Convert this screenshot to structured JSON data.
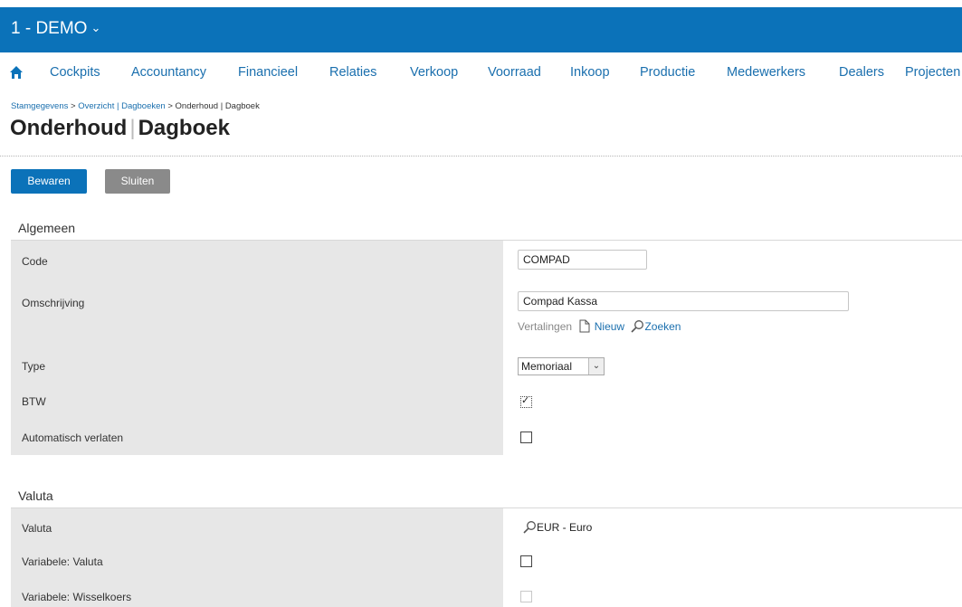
{
  "header": {
    "company": "1 - DEMO"
  },
  "menu": {
    "items": [
      "Cockpits",
      "Accountancy",
      "Financieel",
      "Relaties",
      "Verkoop",
      "Voorraad",
      "Inkoop",
      "Productie",
      "Medewerkers",
      "Dealers",
      "Projecten"
    ]
  },
  "breadcrumb": {
    "root": "Stamgegevens",
    "sep1": ">",
    "overview": "Overzicht | Dagboeken",
    "sep2": ">",
    "current": "Onderhoud | Dagboek"
  },
  "page": {
    "title_main": "Onderhoud",
    "title_sep": "|",
    "title_sub": "Dagboek"
  },
  "toolbar": {
    "save_label": "Bewaren",
    "close_label": "Sluiten"
  },
  "general": {
    "heading": "Algemeen",
    "code_label": "Code",
    "code_value": "COMPAD",
    "description_label": "Omschrijving",
    "description_value": "Compad Kassa",
    "translations_label": "Vertalingen",
    "new_link": "Nieuw",
    "search_link": "Zoeken",
    "type_label": "Type",
    "type_value": "Memoriaal",
    "vat_label": "BTW",
    "vat_checked": true,
    "auto_leave_label": "Automatisch verlaten",
    "auto_leave_checked": false
  },
  "currency": {
    "heading": "Valuta",
    "currency_label": "Valuta",
    "currency_value": "EUR - Euro",
    "var_currency_label": "Variabele: Valuta",
    "var_rate_label": "Variabele: Wisselkoers"
  },
  "colors": {
    "brand": "#0b72b9",
    "link": "#1a6fae",
    "label_bg": "#e7e7e7",
    "secondary_button": "#8a8a8a"
  }
}
